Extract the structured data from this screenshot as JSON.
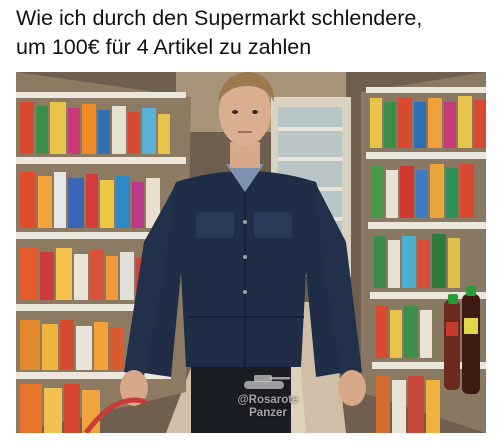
{
  "meme": {
    "caption_line1": "Wie ich durch den Supermarkt schlendere,",
    "caption_line2": "um 100€ für 4 Artikel zu zahlen"
  },
  "photo": {
    "scene": "supermarket aisle",
    "colors": {
      "jacket": "#1f2d46",
      "shelf_light": "#e8e3d8",
      "aisle_floor": "#cdbda6"
    }
  },
  "watermark": {
    "line1": "@Rosarote",
    "line2": "Panzer",
    "icon": "tank-icon"
  }
}
